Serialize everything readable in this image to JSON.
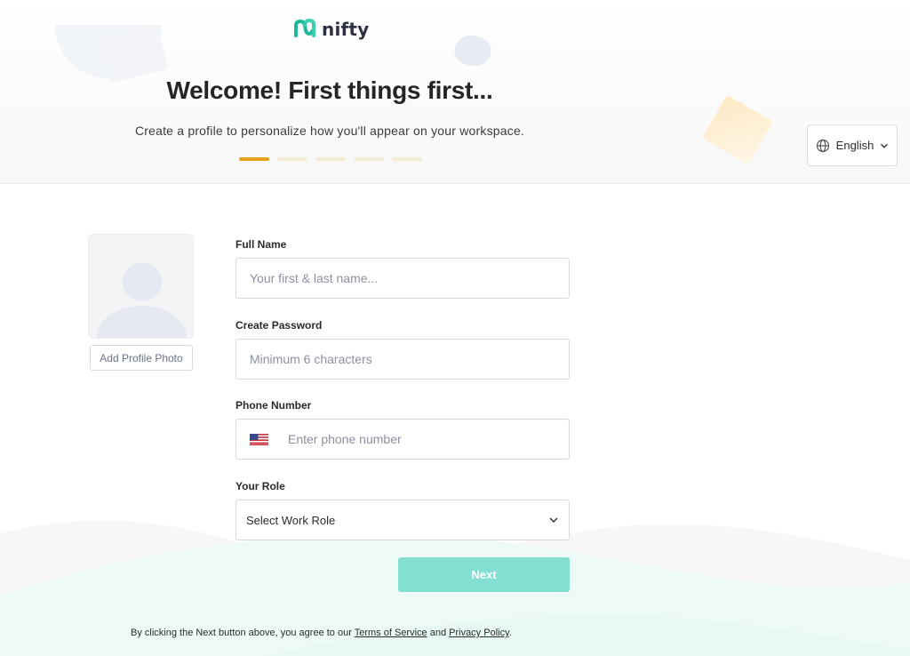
{
  "brand": {
    "name": "nifty",
    "color_primary": "#1fb89a",
    "color_dark": "#2d3142"
  },
  "header": {
    "title": "Welcome! First things first...",
    "subtitle": "Create a profile to personalize how you'll appear on your workspace.",
    "steps": {
      "total": 5,
      "current": 1,
      "active_color": "#e8a11a",
      "inactive_color": "#f5ecd5"
    }
  },
  "language": {
    "label": "English",
    "icon": "globe-icon"
  },
  "profile": {
    "add_photo_label": "Add Profile Photo"
  },
  "form": {
    "full_name": {
      "label": "Full Name",
      "placeholder": "Your first & last name..."
    },
    "password": {
      "label": "Create Password",
      "placeholder": "Minimum 6 characters"
    },
    "phone": {
      "label": "Phone Number",
      "placeholder": "Enter phone number",
      "country_flag": "us-flag-icon"
    },
    "role": {
      "label": "Your Role",
      "selected": "Select Work Role"
    },
    "next_label": "Next",
    "next_color": "#84dfd3"
  },
  "legal": {
    "prefix": "By clicking the Next button above, you agree to our ",
    "terms": "Terms of Service",
    "and": " and ",
    "privacy": "Privacy Policy",
    "suffix": "."
  }
}
